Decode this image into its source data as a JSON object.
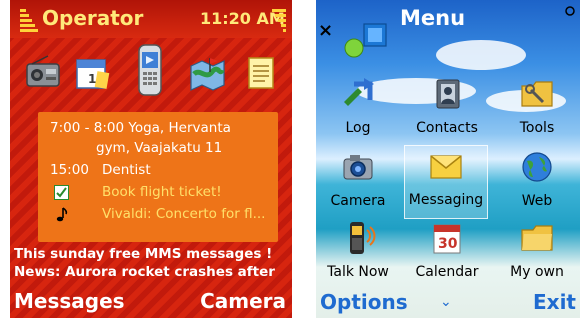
{
  "standby": {
    "status": {
      "operator": "Operator",
      "time": "11:20 AM"
    },
    "shortcuts": [
      {
        "icon": "radio-icon"
      },
      {
        "icon": "calendar-icon"
      },
      {
        "icon": "phone-icon",
        "selected": true
      },
      {
        "icon": "map-icon"
      },
      {
        "icon": "notes-icon"
      }
    ],
    "agenda": {
      "line1": "7:00 - 8:00  Yoga, Hervanta",
      "line2": "gym, Vaajakatu 11",
      "line3_time": "15:00",
      "line3_text": "Dentist",
      "line4": "Book flight ticket!",
      "line5": "Vivaldi: Concerto for fl..."
    },
    "ticker": [
      "This sunday free MMS messages !",
      "News: Aurora rocket crashes after"
    ],
    "softkeys": {
      "left": "Messages",
      "right": "Camera"
    }
  },
  "menu": {
    "title": "Menu",
    "close": "×",
    "items": [
      {
        "label": "Log",
        "icon": "log-icon"
      },
      {
        "label": "Contacts",
        "icon": "contacts-icon"
      },
      {
        "label": "Tools",
        "icon": "tools-icon"
      },
      {
        "label": "Camera",
        "icon": "camera-icon"
      },
      {
        "label": "Messaging",
        "icon": "messaging-icon",
        "selected": true
      },
      {
        "label": "Web",
        "icon": "web-icon"
      },
      {
        "label": "Talk Now",
        "icon": "talk-now-icon"
      },
      {
        "label": "Calendar",
        "icon": "calendar-icon"
      },
      {
        "label": "My own",
        "icon": "my-own-icon"
      }
    ],
    "calendar_day": "30",
    "softkeys": {
      "left": "Options",
      "middle": "⌄",
      "right": "Exit"
    }
  }
}
